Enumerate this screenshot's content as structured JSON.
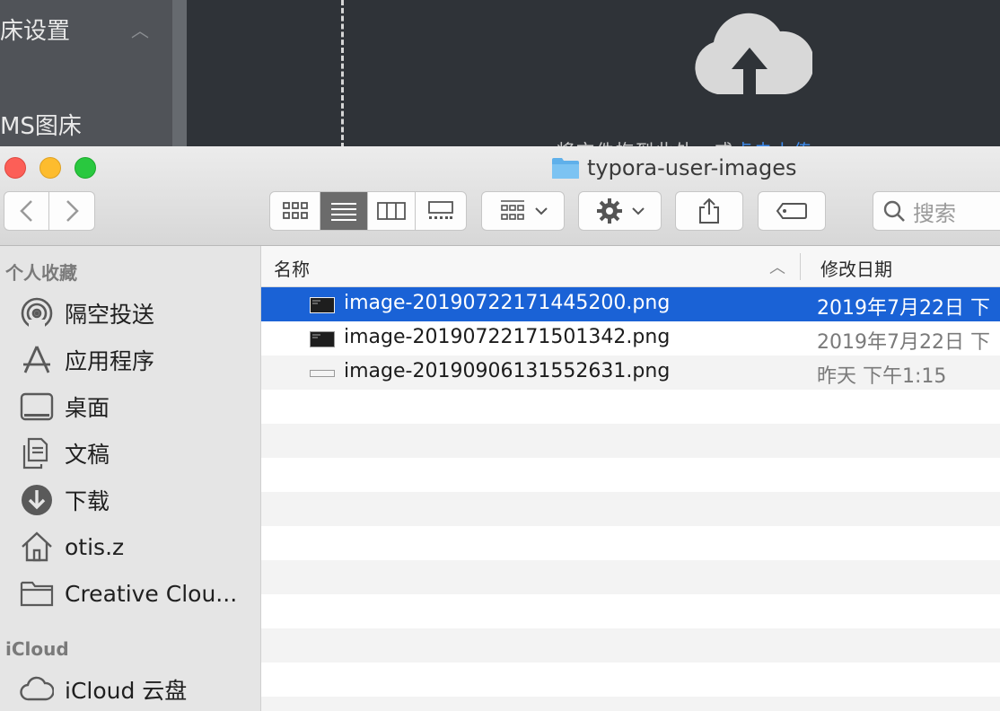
{
  "background_app": {
    "sidebar_title": "床设置",
    "sidebar_item": "MS图床",
    "hint_text": "将文件拖到此处，或",
    "hint_link": "点击上传"
  },
  "window": {
    "title": "typora-user-images"
  },
  "toolbar": {
    "search_placeholder": "搜索",
    "icons": [
      "back-arrow",
      "forward-arrow",
      "icon-view",
      "list-view",
      "column-view",
      "gallery-view",
      "group-by",
      "gear",
      "share",
      "tag",
      "search"
    ]
  },
  "sidebar": {
    "favorites_header": "个人收藏",
    "favorites": [
      {
        "label": "隔空投送",
        "icon": "airdrop-icon"
      },
      {
        "label": "应用程序",
        "icon": "applications-icon"
      },
      {
        "label": "桌面",
        "icon": "desktop-icon"
      },
      {
        "label": "文稿",
        "icon": "documents-icon"
      },
      {
        "label": "下载",
        "icon": "downloads-icon"
      },
      {
        "label": "otis.z",
        "icon": "home-icon"
      },
      {
        "label": "Creative Clou...",
        "icon": "folder-icon"
      }
    ],
    "icloud_header": "iCloud",
    "icloud": [
      {
        "label": "iCloud 云盘",
        "icon": "cloud-icon"
      }
    ]
  },
  "list": {
    "col_name": "名称",
    "col_date": "修改日期",
    "sort_arrow": "^",
    "files": [
      {
        "name": "image-20190722171445200.png",
        "date": "2019年7月22日 下",
        "selected": true
      },
      {
        "name": "image-20190722171501342.png",
        "date": "2019年7月22日 下",
        "selected": false
      },
      {
        "name": "image-20190906131552631.png",
        "date": "昨天 下午1:15",
        "selected": false
      }
    ]
  },
  "colors": {
    "selection": "#1a62d6",
    "close": "#fc5f57",
    "minimize": "#fdbc2e",
    "zoom": "#29c83f",
    "folder": "#5fb0ea"
  }
}
